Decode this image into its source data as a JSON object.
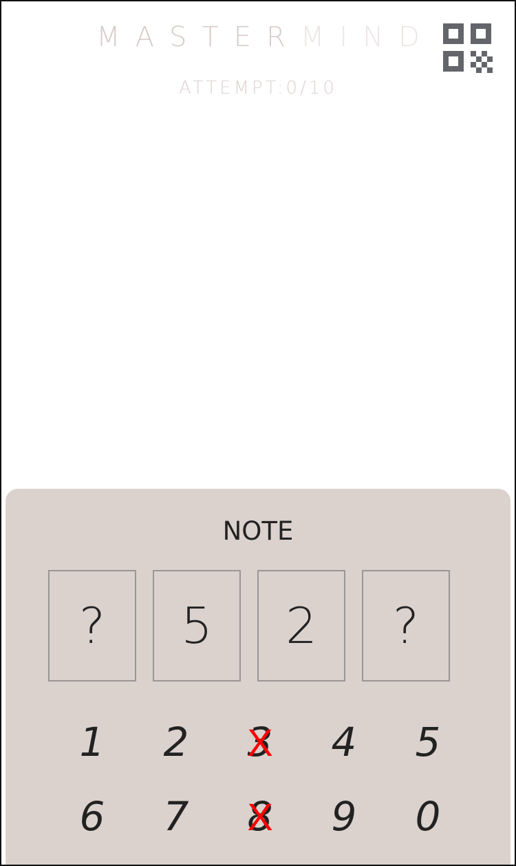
{
  "header": {
    "title_letters": [
      "M",
      "A",
      "S",
      "T",
      "E",
      "R",
      "M",
      "I",
      "N",
      "D"
    ],
    "title_colors": [
      "#d7ccca",
      "#d7ccca",
      "#d7ccca",
      "#d7ccca",
      "#d7ccca",
      "#d7ccca",
      "#ece6e4",
      "#ece6e4",
      "#ece6e4",
      "#ece6e4"
    ],
    "attempt_label": "ATTEMPT:0/10",
    "qr_icon": "qr-code-icon",
    "qr_icon_color": "#63656a"
  },
  "note": {
    "title": "NOTE",
    "slots": [
      "?",
      "5",
      "2",
      "?"
    ],
    "digits_row1": [
      "1",
      "2",
      "3",
      "4",
      "5"
    ],
    "digits_row2": [
      "6",
      "7",
      "8",
      "9",
      "0"
    ],
    "excluded_digits": [
      "3",
      "8"
    ],
    "exclude_mark": "X",
    "exclude_color": "#ff0000",
    "panel_color": "#dbd2cd"
  }
}
